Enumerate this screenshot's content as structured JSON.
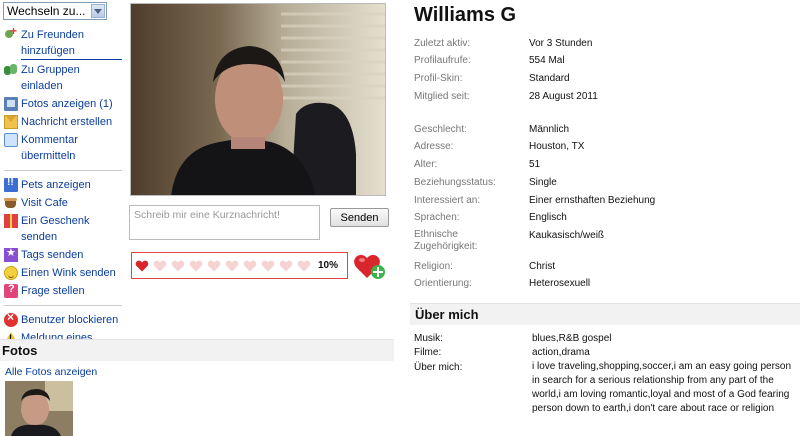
{
  "switcher": {
    "value": "Wechseln zu..."
  },
  "actions": [
    {
      "label": "Zu Freunden hinzufügen",
      "icon": "add-friend-icon"
    },
    {
      "label": "Zu Gruppen einladen",
      "icon": "group-icon"
    },
    {
      "label": "Fotos anzeigen (1)",
      "icon": "photo-icon"
    },
    {
      "label": "Nachricht erstellen",
      "icon": "mail-icon"
    },
    {
      "label": "Kommentar übermitteln",
      "icon": "comment-icon"
    },
    {
      "label": "Pets anzeigen",
      "icon": "pets-icon"
    },
    {
      "label": "Visit Cafe",
      "icon": "cafe-icon"
    },
    {
      "label": "Ein Geschenk senden",
      "icon": "gift-icon"
    },
    {
      "label": "Tags senden",
      "icon": "tag-icon"
    },
    {
      "label": "Einen Wink senden",
      "icon": "wink-icon"
    },
    {
      "label": "Frage stellen",
      "icon": "question-icon"
    },
    {
      "label": "Benutzer blockieren",
      "icon": "block-icon"
    },
    {
      "label": "Meldung eines Verstoßes",
      "icon": "warning-icon"
    }
  ],
  "photos": {
    "title": "Fotos",
    "all_link": "Alle Fotos anzeigen"
  },
  "message": {
    "placeholder": "Schreib mir eine Kurznachricht!",
    "send_label": "Senden"
  },
  "rating": {
    "percent_label": "10%",
    "filled": 1,
    "total": 10
  },
  "profile": {
    "name": "Williams G",
    "rows": [
      {
        "label": "Zuletzt aktiv:",
        "value": "Vor 3 Stunden"
      },
      {
        "label": "Profilaufrufe:",
        "value": "554 Mal"
      },
      {
        "label": "Profil-Skin:",
        "value": "Standard"
      },
      {
        "label": "Mitglied seit:",
        "value": "28 August 2011"
      },
      {
        "label": "Geschlecht:",
        "value": "Männlich"
      },
      {
        "label": "Adresse:",
        "value": "Houston, TX"
      },
      {
        "label": "Alter:",
        "value": "51"
      },
      {
        "label": "Beziehungsstatus:",
        "value": "Single"
      },
      {
        "label": "Interessiert an:",
        "value": "Einer ernsthaften Beziehung"
      },
      {
        "label": "Sprachen:",
        "value": "Englisch"
      },
      {
        "label": "Ethnische Zugehörigkeit:",
        "value": "Kaukasisch/weiß"
      },
      {
        "label": "Religion:",
        "value": "Christ"
      },
      {
        "label": "Orientierung:",
        "value": "Heterosexuell"
      }
    ]
  },
  "about": {
    "title": "Über mich",
    "rows": [
      {
        "label": "Musik:",
        "value": "blues,R&B gospel"
      },
      {
        "label": "Filme:",
        "value": "action,drama"
      },
      {
        "label": "Über mich:",
        "value": "i love traveling,shopping,soccer,i am an easy going person in search for a serious relationship from any part of the world,i am loving romantic,loyal and most of a God fearing person down to earth,i don't care about race or religion"
      }
    ]
  },
  "colors": {
    "link": "#0a3d9c",
    "heart_filled": "#d9262c",
    "heart_empty": "#f6d3d3",
    "rating_border": "#e04444"
  }
}
